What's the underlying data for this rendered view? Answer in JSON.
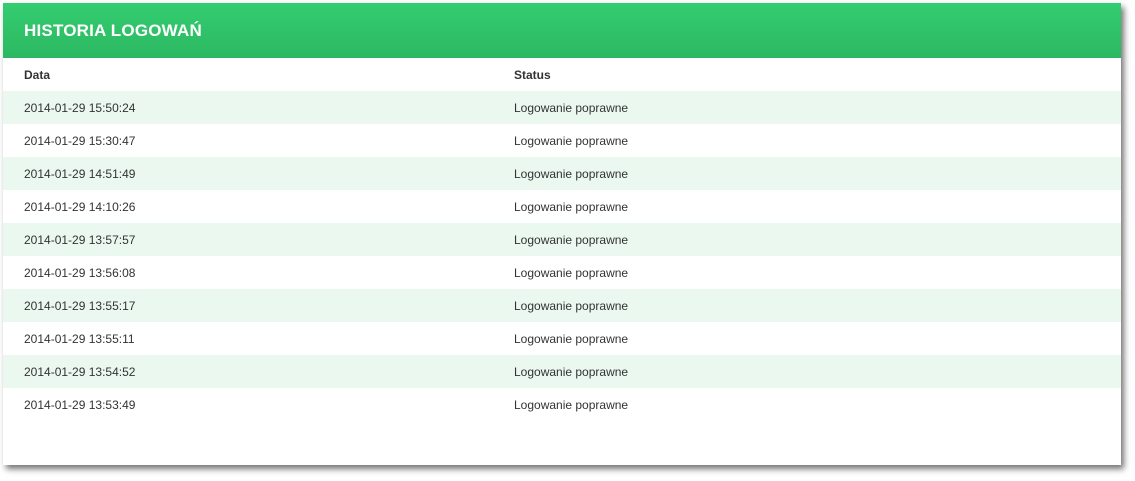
{
  "panel": {
    "title": "HISTORIA LOGOWAŃ"
  },
  "table": {
    "columns": [
      "Data",
      "Status"
    ],
    "rows": [
      {
        "date": "2014-01-29 15:50:24",
        "status": "Logowanie poprawne"
      },
      {
        "date": "2014-01-29 15:30:47",
        "status": "Logowanie poprawne"
      },
      {
        "date": "2014-01-29 14:51:49",
        "status": "Logowanie poprawne"
      },
      {
        "date": "2014-01-29 14:10:26",
        "status": "Logowanie poprawne"
      },
      {
        "date": "2014-01-29 13:57:57",
        "status": "Logowanie poprawne"
      },
      {
        "date": "2014-01-29 13:56:08",
        "status": "Logowanie poprawne"
      },
      {
        "date": "2014-01-29 13:55:17",
        "status": "Logowanie poprawne"
      },
      {
        "date": "2014-01-29 13:55:11",
        "status": "Logowanie poprawne"
      },
      {
        "date": "2014-01-29 13:54:52",
        "status": "Logowanie poprawne"
      },
      {
        "date": "2014-01-29 13:53:49",
        "status": "Logowanie poprawne"
      }
    ]
  },
  "colors": {
    "header_green": "#2ec467",
    "stripe": "#eaf8ef",
    "text": "#333333"
  }
}
